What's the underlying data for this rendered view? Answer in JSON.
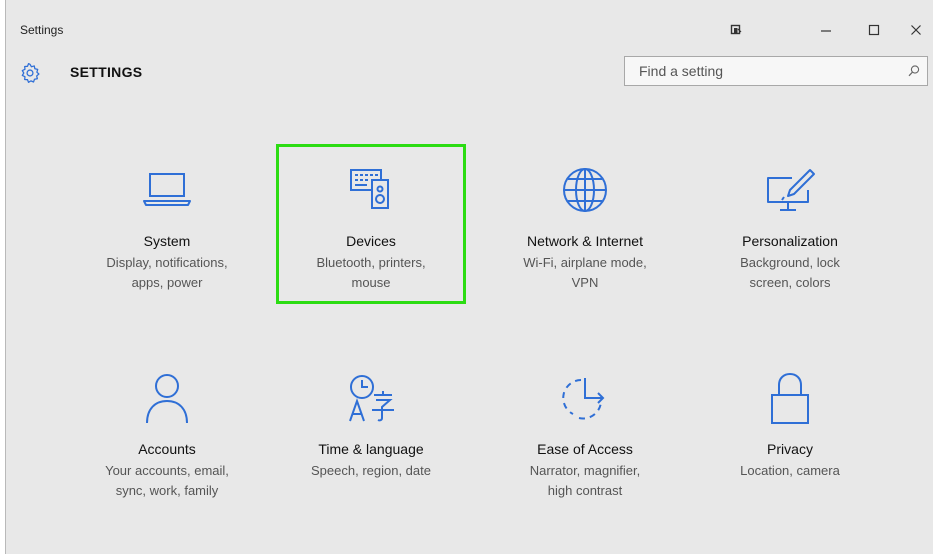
{
  "window": {
    "title": "Settings",
    "controls": {
      "snap": "snap-icon",
      "minimize": "minimize-icon",
      "maximize": "maximize-icon",
      "close": "close-icon"
    }
  },
  "header": {
    "icon": "gear-icon",
    "title": "SETTINGS"
  },
  "search": {
    "placeholder": "Find a setting",
    "value": "",
    "icon": "search-icon"
  },
  "accent_color": "#2f6fd6",
  "selection_color": "#2bdc12",
  "categories": [
    {
      "name": "System",
      "description_line1": "Display, notifications,",
      "description_line2": "apps, power",
      "icon": "laptop-icon"
    },
    {
      "name": "Devices",
      "description_line1": "Bluetooth, printers,",
      "description_line2": "mouse",
      "icon": "devices-icon",
      "selected": true
    },
    {
      "name": "Network & Internet",
      "description_line1": "Wi-Fi, airplane mode,",
      "description_line2": "VPN",
      "icon": "globe-icon"
    },
    {
      "name": "Personalization",
      "description_line1": "Background, lock",
      "description_line2": "screen, colors",
      "icon": "paintbrush-monitor-icon"
    },
    {
      "name": "Accounts",
      "description_line1": "Your accounts, email,",
      "description_line2": "sync, work, family",
      "icon": "person-icon"
    },
    {
      "name": "Time & language",
      "description_line1": "Speech, region, date",
      "description_line2": "",
      "icon": "clock-language-icon"
    },
    {
      "name": "Ease of Access",
      "description_line1": "Narrator, magnifier,",
      "description_line2": "high contrast",
      "icon": "ease-of-access-icon"
    },
    {
      "name": "Privacy",
      "description_line1": "Location, camera",
      "description_line2": "",
      "icon": "lock-icon"
    }
  ]
}
